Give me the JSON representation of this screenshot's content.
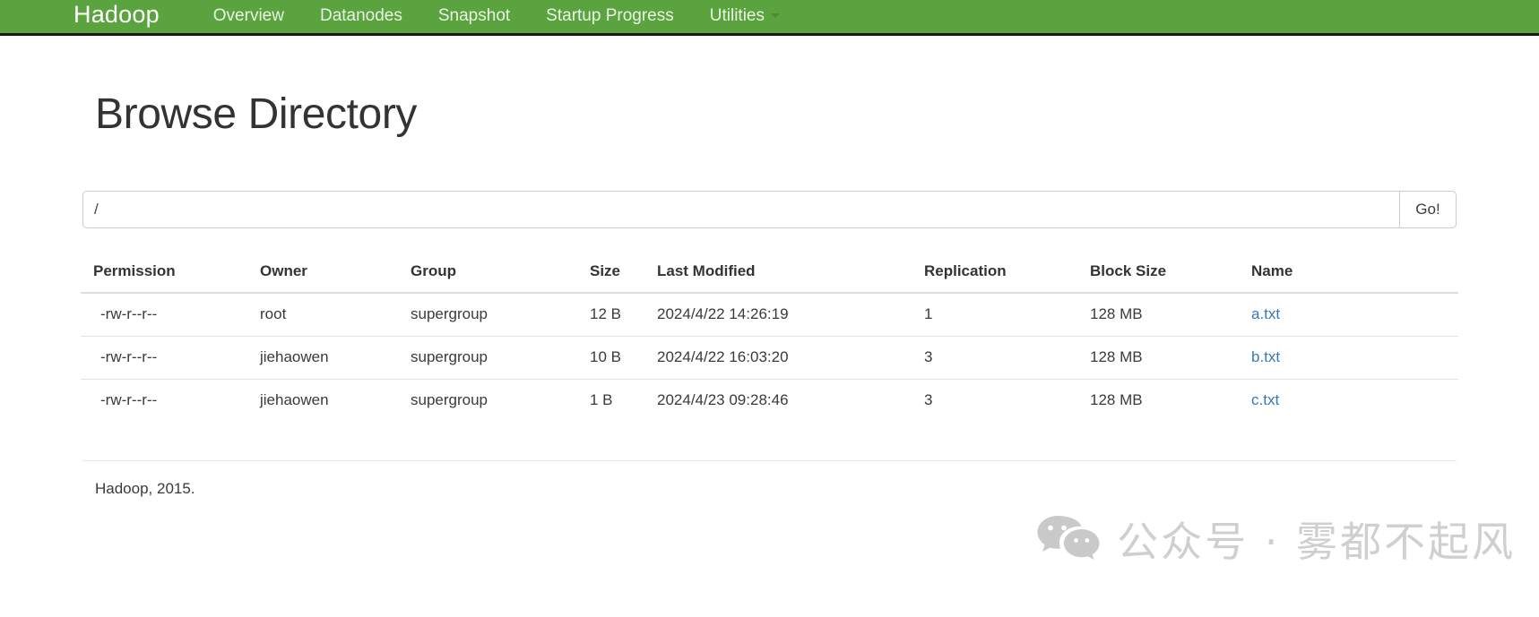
{
  "navbar": {
    "brand": "Hadoop",
    "items": [
      {
        "label": "Overview",
        "icon": ""
      },
      {
        "label": "Datanodes",
        "icon": ""
      },
      {
        "label": "Snapshot",
        "icon": ""
      },
      {
        "label": "Startup Progress",
        "icon": ""
      },
      {
        "label": "Utilities",
        "icon": "chevron-down-icon"
      }
    ],
    "background_color": "#5aa33e",
    "text_color": "#eaf4e6"
  },
  "page": {
    "title": "Browse Directory"
  },
  "path_form": {
    "value": "/",
    "placeholder": "/",
    "go_label": "Go!"
  },
  "table": {
    "headers": [
      "Permission",
      "Owner",
      "Group",
      "Size",
      "Last Modified",
      "Replication",
      "Block Size",
      "Name"
    ],
    "rows": [
      {
        "permission": "-rw-r--r--",
        "owner": "root",
        "group": "supergroup",
        "size": "12 B",
        "last_modified": "2024/4/22 14:26:19",
        "replication": "1",
        "block_size": "128 MB",
        "name": "a.txt"
      },
      {
        "permission": "-rw-r--r--",
        "owner": "jiehaowen",
        "group": "supergroup",
        "size": "10 B",
        "last_modified": "2024/4/22 16:03:20",
        "replication": "3",
        "block_size": "128 MB",
        "name": "b.txt"
      },
      {
        "permission": "-rw-r--r--",
        "owner": "jiehaowen",
        "group": "supergroup",
        "size": "1 B",
        "last_modified": "2024/4/23 09:28:46",
        "replication": "3",
        "block_size": "128 MB",
        "name": "c.txt"
      }
    ],
    "link_color": "#337ab7"
  },
  "footer": {
    "text": "Hadoop, 2015."
  },
  "watermark": {
    "icon": "wechat-icon",
    "text": "公众号 · 雾都不起风",
    "color": "#cfcfcf"
  }
}
